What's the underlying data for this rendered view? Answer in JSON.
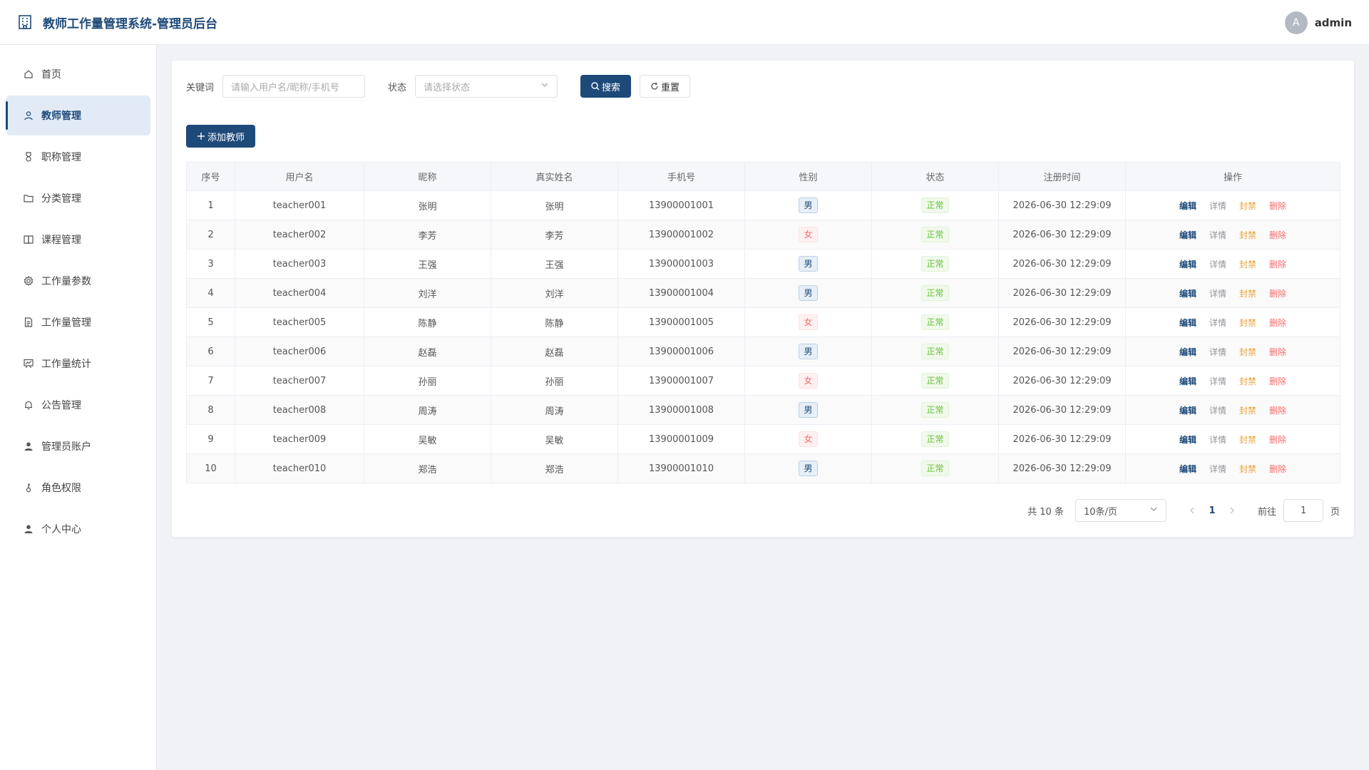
{
  "header": {
    "title": "教师工作量管理系统-管理员后台",
    "user": {
      "avatar_letter": "A",
      "name": "admin"
    }
  },
  "sidebar": {
    "items": [
      {
        "label": "首页",
        "icon": "home-icon",
        "active": false
      },
      {
        "label": "教师管理",
        "icon": "user-icon",
        "active": true
      },
      {
        "label": "职称管理",
        "icon": "medal-icon",
        "active": false
      },
      {
        "label": "分类管理",
        "icon": "folder-icon",
        "active": false
      },
      {
        "label": "课程管理",
        "icon": "book-icon",
        "active": false
      },
      {
        "label": "工作量参数",
        "icon": "gear-icon",
        "active": false
      },
      {
        "label": "工作量管理",
        "icon": "document-icon",
        "active": false
      },
      {
        "label": "工作量统计",
        "icon": "chart-board-icon",
        "active": false
      },
      {
        "label": "公告管理",
        "icon": "bell-icon",
        "active": false
      },
      {
        "label": "管理员账户",
        "icon": "person-filled-icon",
        "active": false
      },
      {
        "label": "角色权限",
        "icon": "key-icon",
        "active": false
      },
      {
        "label": "个人中心",
        "icon": "person-filled-icon",
        "active": false
      }
    ]
  },
  "filter": {
    "keyword_label": "关键词",
    "keyword_placeholder": "请输入用户名/昵称/手机号",
    "status_label": "状态",
    "status_placeholder": "请选择状态",
    "search_label": "搜索",
    "reset_label": "重置"
  },
  "add_button": "添加教师",
  "table": {
    "columns": [
      "序号",
      "用户名",
      "昵称",
      "真实姓名",
      "手机号",
      "性别",
      "状态",
      "注册时间",
      "操作"
    ],
    "actions": {
      "edit": "编辑",
      "detail": "详情",
      "ban": "封禁",
      "delete": "删除"
    },
    "rows": [
      {
        "index": "1",
        "username": "teacher001",
        "nickname": "张明",
        "realname": "张明",
        "phone": "13900001001",
        "gender": "男",
        "status": "正常",
        "registered": "2026-06-30 12:29:09"
      },
      {
        "index": "2",
        "username": "teacher002",
        "nickname": "李芳",
        "realname": "李芳",
        "phone": "13900001002",
        "gender": "女",
        "status": "正常",
        "registered": "2026-06-30 12:29:09"
      },
      {
        "index": "3",
        "username": "teacher003",
        "nickname": "王强",
        "realname": "王强",
        "phone": "13900001003",
        "gender": "男",
        "status": "正常",
        "registered": "2026-06-30 12:29:09"
      },
      {
        "index": "4",
        "username": "teacher004",
        "nickname": "刘洋",
        "realname": "刘洋",
        "phone": "13900001004",
        "gender": "男",
        "status": "正常",
        "registered": "2026-06-30 12:29:09"
      },
      {
        "index": "5",
        "username": "teacher005",
        "nickname": "陈静",
        "realname": "陈静",
        "phone": "13900001005",
        "gender": "女",
        "status": "正常",
        "registered": "2026-06-30 12:29:09"
      },
      {
        "index": "6",
        "username": "teacher006",
        "nickname": "赵磊",
        "realname": "赵磊",
        "phone": "13900001006",
        "gender": "男",
        "status": "正常",
        "registered": "2026-06-30 12:29:09"
      },
      {
        "index": "7",
        "username": "teacher007",
        "nickname": "孙丽",
        "realname": "孙丽",
        "phone": "13900001007",
        "gender": "女",
        "status": "正常",
        "registered": "2026-06-30 12:29:09"
      },
      {
        "index": "8",
        "username": "teacher008",
        "nickname": "周涛",
        "realname": "周涛",
        "phone": "13900001008",
        "gender": "男",
        "status": "正常",
        "registered": "2026-06-30 12:29:09"
      },
      {
        "index": "9",
        "username": "teacher009",
        "nickname": "吴敏",
        "realname": "吴敏",
        "phone": "13900001009",
        "gender": "女",
        "status": "正常",
        "registered": "2026-06-30 12:29:09"
      },
      {
        "index": "10",
        "username": "teacher010",
        "nickname": "郑浩",
        "realname": "郑浩",
        "phone": "13900001010",
        "gender": "男",
        "status": "正常",
        "registered": "2026-06-30 12:29:09"
      }
    ]
  },
  "pagination": {
    "total_text": "共 10 条",
    "page_size": "10条/页",
    "current_page": "1",
    "goto_label": "前往",
    "goto_value": "1",
    "page_suffix": "页"
  },
  "colors": {
    "primary": "#1e4a7a",
    "active_bg": "#e2ebf5",
    "danger": "#f56c6c",
    "warning": "#e6a23c",
    "success": "#67c23a"
  }
}
